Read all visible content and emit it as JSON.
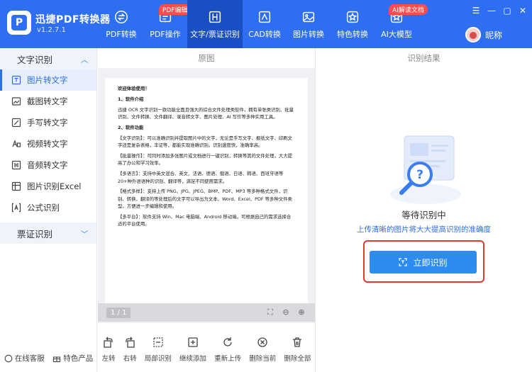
{
  "app": {
    "name": "迅捷PDF转换器",
    "version": "v1.2.7.1",
    "logo_letter": "P"
  },
  "nav": [
    {
      "label": "PDF转换",
      "icon": "convert-icon",
      "badge": ""
    },
    {
      "label": "PDF操作",
      "icon": "pdf-operate-icon",
      "badge": "PDF编辑"
    },
    {
      "label": "文字/票证识别",
      "icon": "ocr-icon",
      "badge": "",
      "active": true
    },
    {
      "label": "CAD转换",
      "icon": "cad-icon",
      "badge": ""
    },
    {
      "label": "图片转换",
      "icon": "image-icon",
      "badge": ""
    },
    {
      "label": "特色转换",
      "icon": "star-icon",
      "badge": ""
    },
    {
      "label": "AI大模型",
      "icon": "ai-icon",
      "badge": "AI解读文档"
    }
  ],
  "user": {
    "name": "昵称"
  },
  "window_controls": [
    "☰",
    "—",
    "▢",
    "✕"
  ],
  "sidebar": {
    "group1": "文字识别",
    "items": [
      {
        "label": "图片转文字",
        "icon": "image-text-icon",
        "active": true
      },
      {
        "label": "截图转文字",
        "icon": "screenshot-icon"
      },
      {
        "label": "手写转文字",
        "icon": "handwriting-icon"
      },
      {
        "label": "视频转文字",
        "icon": "video-icon"
      },
      {
        "label": "音频转文字",
        "icon": "audio-icon"
      },
      {
        "label": "图片识别Excel",
        "icon": "excel-icon"
      },
      {
        "label": "公式识别",
        "icon": "formula-icon"
      }
    ],
    "group2": "票证识别",
    "bottom": {
      "service": "在线客服",
      "features": "特色产品"
    }
  },
  "headers": {
    "left": "原图",
    "right": "识别结果"
  },
  "document": {
    "lines": [
      {
        "t": "欢迎体验使用！",
        "b": true
      },
      {
        "t": "1、软件介绍",
        "b": true
      },
      {
        "t": "迅捷 OCR 文字识别一款功能全面且强大的综合文件处理类软件，拥有单张类识别、批量识别、文件转换、文件翻译、录音转文字、图片处理、AI 写作等多种实用工具。"
      },
      {
        "t": "2、软件功能",
        "b": true
      },
      {
        "t": "【文字识别】：可以准确识别并提取图片中的文字，无论是手写文字、报纸文字、印刷文字还是复杂表格，丰证等，都能实现准确识别。识别速度快，准确率高。"
      },
      {
        "t": "【批量操作】：可同时添加多张图片或文档进行一键识别，转换等其的文件处理，大大提高了办公和学习效率。"
      },
      {
        "t": "【多语言】：支持中英文混合、英文、法语、德语、俄语、日语、韩语、西班牙语等 20+种外语语种的识别、翻译等，满足不同使用需求。"
      },
      {
        "t": "【格式多样】：支持上传 PNG、JPG、JPEG、BMP、PDF、MP3 等多种格式文件，识别、转换、翻译的等处理后的文字可以导出为文本、Word、Excel、PDF 等多种文件类型，方便进一步编辑和使用。"
      },
      {
        "t": "【多平台】：软件支持 Win、Mac 电脑端、Android 移动端，可根据自己的需求选择合适的平台使用。"
      }
    ]
  },
  "pager": {
    "page": "1 / 1"
  },
  "toolbar": [
    {
      "label": "左转",
      "icon": "rotate-left-icon"
    },
    {
      "label": "右转",
      "icon": "rotate-right-icon"
    },
    {
      "label": "局部识别",
      "icon": "crop-icon"
    },
    {
      "label": "继续添加",
      "icon": "add-icon"
    },
    {
      "label": "重新上传",
      "icon": "reupload-icon"
    },
    {
      "label": "删除当前",
      "icon": "delete-current-icon"
    },
    {
      "label": "删除全部",
      "icon": "delete-all-icon"
    }
  ],
  "result": {
    "title": "等待识别中",
    "subtitle": "上传清晰的图片将大大提高识别的准确度",
    "button": "立即识别"
  },
  "colors": {
    "primary": "#2e6ef0",
    "nav_active": "#1a4fc4",
    "highlight_border": "#e0392f",
    "button": "#2e8bf0"
  }
}
